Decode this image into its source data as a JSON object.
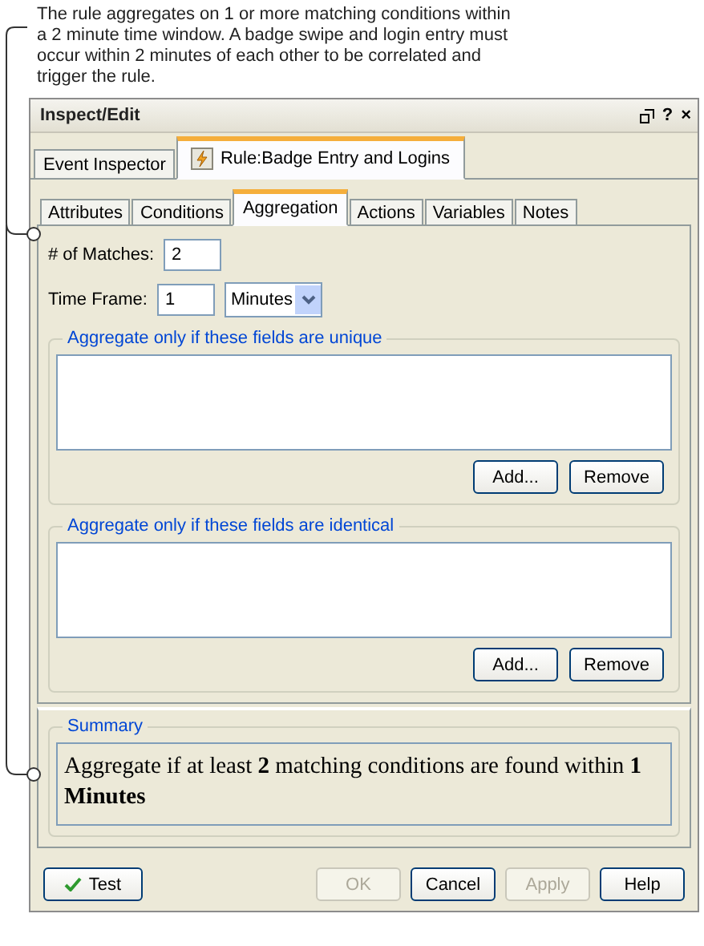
{
  "callout": {
    "text": "The rule aggregates on 1 or more matching conditions within a 2 minute time window. A badge swipe and login entry must occur within 2 minutes of each other to be correlated and trigger the rule."
  },
  "window": {
    "title": "Inspect/Edit",
    "controls": [
      "?",
      "×"
    ]
  },
  "outer_tabs": [
    {
      "label": "Event Inspector",
      "selected": false,
      "kind": "plain"
    },
    {
      "label": "Rule:Badge Entry and Logins",
      "selected": true,
      "kind": "rule"
    }
  ],
  "tabs": [
    {
      "label": "Attributes",
      "selected": false
    },
    {
      "label": "Conditions",
      "selected": false
    },
    {
      "label": "Aggregation",
      "selected": true
    },
    {
      "label": "Actions",
      "selected": false
    },
    {
      "label": "Variables",
      "selected": false
    },
    {
      "label": "Notes",
      "selected": false
    }
  ],
  "matches": {
    "label": "# of Matches:",
    "value": "2"
  },
  "time_frame": {
    "label": "Time Frame:",
    "value": "1",
    "unit": "Minutes"
  },
  "groups": [
    {
      "title": "Aggregate only if these fields are unique",
      "buttons": [
        "Add...",
        "Remove"
      ]
    },
    {
      "title": "Aggregate only if these fields are identical",
      "buttons": [
        "Add...",
        "Remove"
      ]
    }
  ],
  "summary": {
    "title": "Summary",
    "text": "Aggregate if at least **2** matching conditions are found within **1 Minutes**"
  },
  "buttons": [
    {
      "label": "Test",
      "kind": "test",
      "disabled": false
    },
    {
      "label": "OK",
      "kind": "plain",
      "disabled": true
    },
    {
      "label": "Cancel",
      "kind": "plain",
      "disabled": false
    },
    {
      "label": "Apply",
      "kind": "plain",
      "disabled": true
    },
    {
      "label": "Help",
      "kind": "plain",
      "disabled": false
    }
  ]
}
